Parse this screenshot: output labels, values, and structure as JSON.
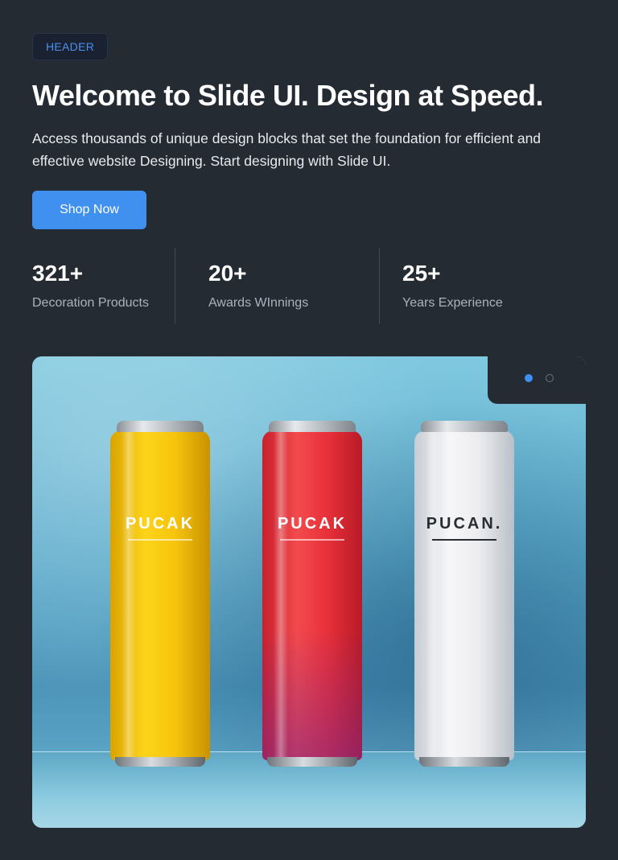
{
  "header": {
    "badge": "HEADER",
    "title": "Welcome to Slide UI. Design at Speed.",
    "description": "Access thousands of unique design blocks that set the foundation for efficient and effective website Designing. Start designing with Slide UI.",
    "cta_label": "Shop Now"
  },
  "stats": [
    {
      "value": "321+",
      "label": "Decoration Products"
    },
    {
      "value": "20+",
      "label": "Awards WInnings"
    },
    {
      "value": "25+",
      "label": "Years Experience"
    }
  ],
  "hero": {
    "cans": [
      {
        "brand": "PUCAK",
        "color": "#f6c40d"
      },
      {
        "brand": "PUCAK",
        "color": "#e8303a"
      },
      {
        "brand": "PUCAN.",
        "color": "#ececef"
      }
    ],
    "carousel": {
      "slides": 2,
      "active_index": 0
    }
  },
  "colors": {
    "background": "#252b32",
    "accent": "#4090f0"
  }
}
